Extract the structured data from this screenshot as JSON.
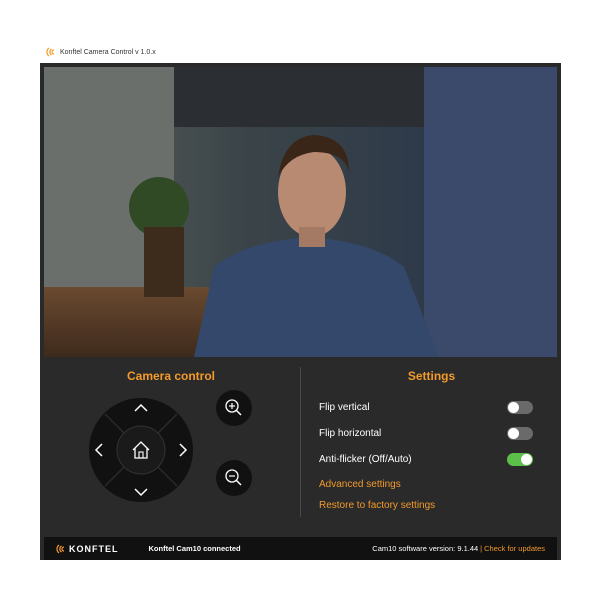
{
  "window": {
    "title": "Konftel Camera Control v 1.0.x"
  },
  "video": {
    "description_icon": "camera-feed"
  },
  "camera_control": {
    "title": "Camera control",
    "buttons": [
      "up-icon",
      "down-icon",
      "left-icon",
      "right-icon",
      "home-icon",
      "zoom-in-icon",
      "zoom-out-icon"
    ]
  },
  "settings": {
    "title": "Settings",
    "toggles": [
      {
        "label": "Flip vertical",
        "on": false
      },
      {
        "label": "Flip horizontal",
        "on": false
      },
      {
        "label": "Anti-flicker (Off/Auto)",
        "on": true
      }
    ],
    "advanced_link": "Advanced settings",
    "restore_link": "Restore to factory settings"
  },
  "footer": {
    "brand": "KONFTEL",
    "status": "Konftel Cam10 connected",
    "version": "Cam10 software version: 9.1.44",
    "separator": "|",
    "update_link": "Check for updates"
  },
  "colors": {
    "accent": "#f39a2b",
    "panel": "#2a2a2a",
    "toggle_on": "#5bbf4a"
  }
}
